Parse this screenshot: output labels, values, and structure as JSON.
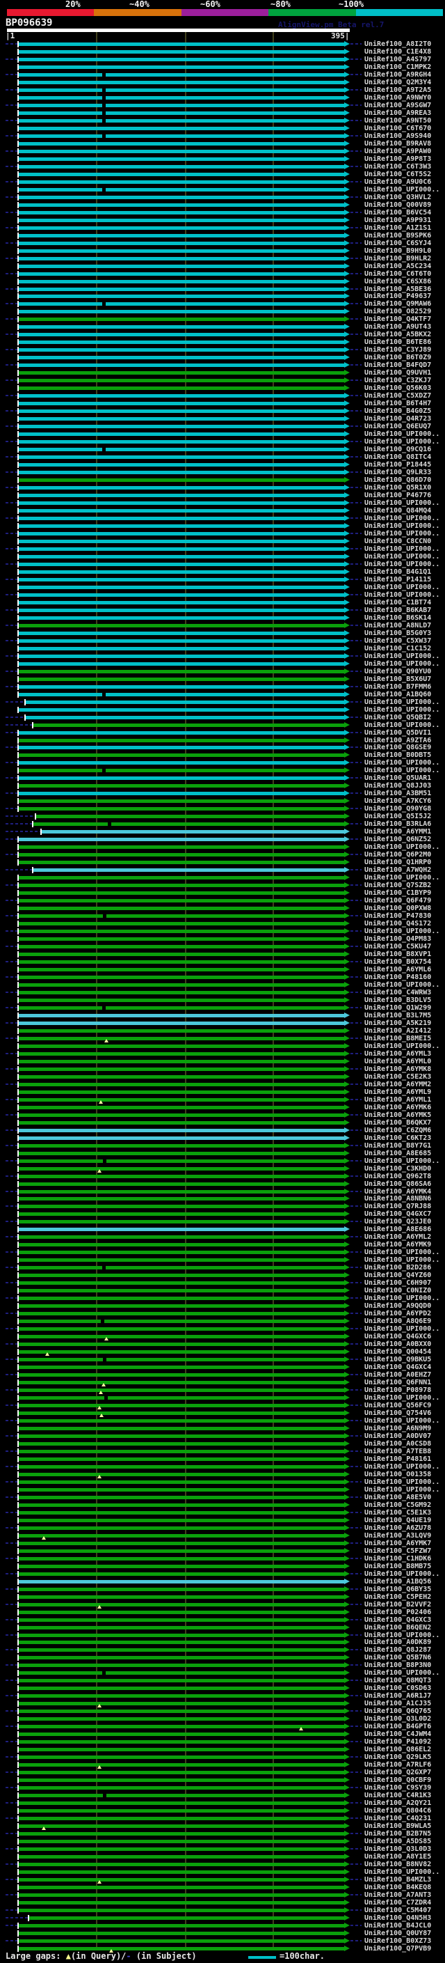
{
  "app": {
    "watermark": "AlignView.pm Beta rel.7"
  },
  "header": {
    "identity_scale": {
      "labels": [
        "20%",
        "~40%",
        "~60%",
        "~80%",
        "~100%"
      ],
      "colors": [
        "#e81930",
        "#d9730b",
        "#9c1f9c",
        "#00a33e",
        "#00bfc8"
      ]
    },
    "query_name": "BP096639",
    "ruler": {
      "start_label": "|1",
      "end_label": "395|",
      "start": 1,
      "end": 395
    }
  },
  "legend": {
    "large_gaps_prefix": "Large gaps: ",
    "query_gap_symbol": "▲",
    "large_gaps_mid": "(in Query)/",
    "subject_gap_symbol": "-",
    "large_gaps_suffix": " (in Subject)",
    "scale_key_label": "=100char."
  },
  "chart_data": {
    "type": "bar",
    "orientation": "horizontal",
    "title": "BP096639",
    "x_axis": {
      "min": 1,
      "max": 395,
      "gridlines": [
        100,
        200,
        300
      ]
    },
    "identity_legend": {
      "cyan": "~100%",
      "lcyan": "~100%",
      "green": "~80%"
    },
    "colors_hex": {
      "cyan": "#00c0c8",
      "lcyan": "#4cc8da",
      "green": "#0aa00b"
    },
    "rows": [
      {
        "l": "UniRef100_A8I2T0",
        "c": "cyan"
      },
      {
        "l": "UniRef100_C1E4X8",
        "c": "cyan"
      },
      {
        "l": "UniRef100_A4S797",
        "c": "cyan"
      },
      {
        "l": "UniRef100_C1MPK2",
        "c": "cyan"
      },
      {
        "l": "UniRef100_A9RGH4",
        "c": "cyan",
        "n": 147
      },
      {
        "l": "UniRef100_Q2M3Y4",
        "c": "cyan"
      },
      {
        "l": "UniRef100_A9T2A5",
        "c": "cyan",
        "n": 147
      },
      {
        "l": "UniRef100_A9NWY0",
        "c": "cyan",
        "n": 147
      },
      {
        "l": "UniRef100_A9SGW7",
        "c": "cyan",
        "n": 147
      },
      {
        "l": "UniRef100_A9REA3",
        "c": "cyan",
        "n": 147
      },
      {
        "l": "UniRef100_A9NT50",
        "c": "cyan",
        "n": 147
      },
      {
        "l": "UniRef100_C6T670",
        "c": "cyan"
      },
      {
        "l": "UniRef100_A9S940",
        "c": "cyan",
        "n": 147
      },
      {
        "l": "UniRef100_B9RAV8",
        "c": "cyan"
      },
      {
        "l": "UniRef100_A9PAW0",
        "c": "cyan"
      },
      {
        "l": "UniRef100_A9P8T3",
        "c": "cyan"
      },
      {
        "l": "UniRef100_C6T3W3",
        "c": "cyan"
      },
      {
        "l": "UniRef100_C6T5S2",
        "c": "cyan"
      },
      {
        "l": "UniRef100_A9U0C6",
        "c": "cyan"
      },
      {
        "l": "UniRef100_UPI000..",
        "c": "cyan",
        "n": 147
      },
      {
        "l": "UniRef100_Q3HVL2",
        "c": "cyan"
      },
      {
        "l": "UniRef100_Q00V89",
        "c": "cyan"
      },
      {
        "l": "UniRef100_B6VC54",
        "c": "cyan"
      },
      {
        "l": "UniRef100_A9P931",
        "c": "cyan"
      },
      {
        "l": "UniRef100_A1Z1S1",
        "c": "cyan"
      },
      {
        "l": "UniRef100_B9SPK6",
        "c": "cyan"
      },
      {
        "l": "UniRef100_C6SYJ4",
        "c": "cyan"
      },
      {
        "l": "UniRef100_B9H9L0",
        "c": "cyan"
      },
      {
        "l": "UniRef100_B9HLR2",
        "c": "cyan"
      },
      {
        "l": "UniRef100_A5C234",
        "c": "cyan"
      },
      {
        "l": "UniRef100_C6T6T0",
        "c": "cyan"
      },
      {
        "l": "UniRef100_C6SX86",
        "c": "cyan"
      },
      {
        "l": "UniRef100_A5BE36",
        "c": "cyan"
      },
      {
        "l": "UniRef100_P49637",
        "c": "cyan"
      },
      {
        "l": "UniRef100_Q9MAW6",
        "c": "cyan",
        "n": 147
      },
      {
        "l": "UniRef100_O82529",
        "c": "cyan"
      },
      {
        "l": "UniRef100_Q4KTF7",
        "c": "green"
      },
      {
        "l": "UniRef100_A9UT43",
        "c": "cyan"
      },
      {
        "l": "UniRef100_A5BKX2",
        "c": "cyan"
      },
      {
        "l": "UniRef100_B6TE86",
        "c": "cyan"
      },
      {
        "l": "UniRef100_C3YJ89",
        "c": "cyan"
      },
      {
        "l": "UniRef100_B6T0Z9",
        "c": "cyan"
      },
      {
        "l": "UniRef100_B4FQD7",
        "c": "cyan"
      },
      {
        "l": "UniRef100_Q9UVH1",
        "c": "green"
      },
      {
        "l": "UniRef100_C3ZKJ7",
        "c": "green"
      },
      {
        "l": "UniRef100_Q56K03",
        "c": "green"
      },
      {
        "l": "UniRef100_C5XDZ7",
        "c": "cyan"
      },
      {
        "l": "UniRef100_B6T4H7",
        "c": "cyan"
      },
      {
        "l": "UniRef100_B4G0Z5",
        "c": "cyan"
      },
      {
        "l": "UniRef100_Q4R723",
        "c": "cyan"
      },
      {
        "l": "UniRef100_Q6EUQ7",
        "c": "cyan"
      },
      {
        "l": "UniRef100_UPI000..",
        "c": "cyan"
      },
      {
        "l": "UniRef100_UPI000..",
        "c": "cyan"
      },
      {
        "l": "UniRef100_Q9CQ16",
        "c": "cyan",
        "n": 147
      },
      {
        "l": "UniRef100_Q8ITC4",
        "c": "cyan"
      },
      {
        "l": "UniRef100_P18445",
        "c": "cyan"
      },
      {
        "l": "UniRef100_Q9LR33",
        "c": "cyan"
      },
      {
        "l": "UniRef100_Q86D70",
        "c": "green"
      },
      {
        "l": "UniRef100_Q5R1X0",
        "c": "cyan"
      },
      {
        "l": "UniRef100_P46776",
        "c": "cyan"
      },
      {
        "l": "UniRef100_UPI000..",
        "c": "cyan"
      },
      {
        "l": "UniRef100_Q84MQ4",
        "c": "cyan"
      },
      {
        "l": "UniRef100_UPI000..",
        "c": "cyan"
      },
      {
        "l": "UniRef100_UPI000..",
        "c": "cyan"
      },
      {
        "l": "UniRef100_UPI000..",
        "c": "cyan"
      },
      {
        "l": "UniRef100_C8CCN0",
        "c": "cyan"
      },
      {
        "l": "UniRef100_UPI000..",
        "c": "cyan"
      },
      {
        "l": "UniRef100_UPI000..",
        "c": "cyan"
      },
      {
        "l": "UniRef100_UPI000..",
        "c": "cyan"
      },
      {
        "l": "UniRef100_B4G1Q1",
        "c": "cyan"
      },
      {
        "l": "UniRef100_P14115",
        "c": "cyan"
      },
      {
        "l": "UniRef100_UPI000..",
        "c": "cyan"
      },
      {
        "l": "UniRef100_UPI000..",
        "c": "cyan"
      },
      {
        "l": "UniRef100_C1BT74",
        "c": "cyan"
      },
      {
        "l": "UniRef100_B6KAB7",
        "c": "cyan"
      },
      {
        "l": "UniRef100_B6SK14",
        "c": "cyan"
      },
      {
        "l": "UniRef100_A8NLD7",
        "c": "green"
      },
      {
        "l": "UniRef100_B5G0Y3",
        "c": "cyan"
      },
      {
        "l": "UniRef100_C5XW37",
        "c": "cyan"
      },
      {
        "l": "UniRef100_C1C152",
        "c": "cyan"
      },
      {
        "l": "UniRef100_UPI000..",
        "c": "cyan"
      },
      {
        "l": "UniRef100_UPI000..",
        "c": "cyan"
      },
      {
        "l": "UniRef100_Q90YU0",
        "c": "green"
      },
      {
        "l": "UniRef100_B5X6U7",
        "c": "green"
      },
      {
        "l": "UniRef100_B7FMM6",
        "c": "cyan"
      },
      {
        "l": "UniRef100_A1BQ60",
        "c": "cyan",
        "n": 147
      },
      {
        "l": "UniRef100_UPI000..",
        "c": "cyan",
        "s": 35
      },
      {
        "l": "UniRef100_UPI000..",
        "c": "cyan"
      },
      {
        "l": "UniRef100_Q5QBI2",
        "c": "cyan",
        "s": 35
      },
      {
        "l": "UniRef100_UPI000..",
        "c": "green",
        "s": 46
      },
      {
        "l": "UniRef100_Q5DVI1",
        "c": "cyan"
      },
      {
        "l": "UniRef100_A9ZTA6",
        "c": "green"
      },
      {
        "l": "UniRef100_Q8GSE9",
        "c": "cyan"
      },
      {
        "l": "UniRef100_B0DBT5",
        "c": "green"
      },
      {
        "l": "UniRef100_UPI000..",
        "c": "cyan"
      },
      {
        "l": "UniRef100_UPI000..",
        "c": "green",
        "n": 147
      },
      {
        "l": "UniRef100_Q5UAR1",
        "c": "cyan"
      },
      {
        "l": "UniRef100_Q8JJ03",
        "c": "green"
      },
      {
        "l": "UniRef100_A3BM51",
        "c": "cyan"
      },
      {
        "l": "UniRef100_A7KCY6",
        "c": "green"
      },
      {
        "l": "UniRef100_Q90YG8",
        "c": "green"
      },
      {
        "l": "UniRef100_Q5I5J2",
        "c": "green",
        "s": 50
      },
      {
        "l": "UniRef100_B3RLA6",
        "c": "green",
        "s": 46,
        "n": 155
      },
      {
        "l": "UniRef100_A6YMM1",
        "c": "lcyan",
        "s": 58
      },
      {
        "l": "UniRef100_Q6NZ52",
        "c": "lcyan"
      },
      {
        "l": "UniRef100_UPI000..",
        "c": "green"
      },
      {
        "l": "UniRef100_Q6P2M0",
        "c": "green"
      },
      {
        "l": "UniRef100_Q1HRP0",
        "c": "green"
      },
      {
        "l": "UniRef100_A7WQH2",
        "c": "lcyan",
        "s": 46
      },
      {
        "l": "UniRef100_UPI000..",
        "c": "green"
      },
      {
        "l": "UniRef100_Q7SZB2",
        "c": "green"
      },
      {
        "l": "UniRef100_C1BYP9",
        "c": "green"
      },
      {
        "l": "UniRef100_Q6F479",
        "c": "green"
      },
      {
        "l": "UniRef100_Q0PXW8",
        "c": "green"
      },
      {
        "l": "UniRef100_P47830",
        "c": "green",
        "n": 148
      },
      {
        "l": "UniRef100_Q4S172",
        "c": "green"
      },
      {
        "l": "UniRef100_UPI000..",
        "c": "green"
      },
      {
        "l": "UniRef100_Q4PM83",
        "c": "green"
      },
      {
        "l": "UniRef100_C5KU47",
        "c": "green"
      },
      {
        "l": "UniRef100_B8XVP1",
        "c": "green"
      },
      {
        "l": "UniRef100_B0X754",
        "c": "green"
      },
      {
        "l": "UniRef100_A6YML6",
        "c": "green"
      },
      {
        "l": "UniRef100_P48160",
        "c": "green"
      },
      {
        "l": "UniRef100_UPI000..",
        "c": "green"
      },
      {
        "l": "UniRef100_C4WRW3",
        "c": "green"
      },
      {
        "l": "UniRef100_B3DLV5",
        "c": "green"
      },
      {
        "l": "UniRef100_Q1W299",
        "c": "green",
        "n": 147
      },
      {
        "l": "UniRef100_B3L7M5",
        "c": "lcyan"
      },
      {
        "l": "UniRef100_A5K219",
        "c": "lcyan"
      },
      {
        "l": "UniRef100_A2I412",
        "c": "green"
      },
      {
        "l": "UniRef100_B8MEI5",
        "c": "green",
        "t": 150
      },
      {
        "l": "UniRef100_UPI000..",
        "c": "green"
      },
      {
        "l": "UniRef100_A6YML3",
        "c": "green"
      },
      {
        "l": "UniRef100_A6YML0",
        "c": "green"
      },
      {
        "l": "UniRef100_A6YMK8",
        "c": "green"
      },
      {
        "l": "UniRef100_C5E2K3",
        "c": "green"
      },
      {
        "l": "UniRef100_A6YMM2",
        "c": "green"
      },
      {
        "l": "UniRef100_A6YML9",
        "c": "green"
      },
      {
        "l": "UniRef100_A6YML1",
        "c": "green",
        "t": 142
      },
      {
        "l": "UniRef100_A6YMK6",
        "c": "green"
      },
      {
        "l": "UniRef100_A6YMK5",
        "c": "green"
      },
      {
        "l": "UniRef100_B6QKX7",
        "c": "green"
      },
      {
        "l": "UniRef100_C6ZQM6",
        "c": "lcyan"
      },
      {
        "l": "UniRef100_C6KT23",
        "c": "lcyan"
      },
      {
        "l": "UniRef100_B8Y7G1",
        "c": "green"
      },
      {
        "l": "UniRef100_A8E685",
        "c": "green"
      },
      {
        "l": "UniRef100_UPI000..",
        "c": "green",
        "n": 148
      },
      {
        "l": "UniRef100_C3KHD0",
        "c": "green",
        "t": 140
      },
      {
        "l": "UniRef100_Q962T8",
        "c": "green"
      },
      {
        "l": "UniRef100_Q86SA6",
        "c": "green"
      },
      {
        "l": "UniRef100_A6YMK4",
        "c": "green"
      },
      {
        "l": "UniRef100_A8NBN6",
        "c": "green"
      },
      {
        "l": "UniRef100_Q7RJ88",
        "c": "green"
      },
      {
        "l": "UniRef100_Q4GXC7",
        "c": "green"
      },
      {
        "l": "UniRef100_Q23JE0",
        "c": "green"
      },
      {
        "l": "UniRef100_A8E686",
        "c": "lcyan"
      },
      {
        "l": "UniRef100_A6YML2",
        "c": "green"
      },
      {
        "l": "UniRef100_A6YMK9",
        "c": "green"
      },
      {
        "l": "UniRef100_UPI000..",
        "c": "green"
      },
      {
        "l": "UniRef100_UPI000..",
        "c": "green"
      },
      {
        "l": "UniRef100_B2D286",
        "c": "green",
        "n": 147
      },
      {
        "l": "UniRef100_Q4YZ60",
        "c": "green"
      },
      {
        "l": "UniRef100_C6H907",
        "c": "green"
      },
      {
        "l": "UniRef100_C0NIZ0",
        "c": "green"
      },
      {
        "l": "UniRef100_UPI000..",
        "c": "green"
      },
      {
        "l": "UniRef100_A9QQD0",
        "c": "green"
      },
      {
        "l": "UniRef100_A6YPD2",
        "c": "green"
      },
      {
        "l": "UniRef100_A8Q6E9",
        "c": "green",
        "n": 145
      },
      {
        "l": "UniRef100_UPI000..",
        "c": "green"
      },
      {
        "l": "UniRef100_Q4GXC6",
        "c": "green",
        "t": 150
      },
      {
        "l": "UniRef100_A0BXX0",
        "c": "green"
      },
      {
        "l": "UniRef100_Q00454",
        "c": "green",
        "t": 65
      },
      {
        "l": "UniRef100_Q9BKU5",
        "c": "green",
        "n": 148
      },
      {
        "l": "UniRef100_Q4GXC4",
        "c": "green"
      },
      {
        "l": "UniRef100_A0EHZ7",
        "c": "green"
      },
      {
        "l": "UniRef100_Q6FNN1",
        "c": "green",
        "t": 146
      },
      {
        "l": "UniRef100_P08978",
        "c": "green",
        "t": 142
      },
      {
        "l": "UniRef100_UPI000..",
        "c": "green",
        "n": 150
      },
      {
        "l": "UniRef100_Q56FC9",
        "c": "green",
        "t": 140
      },
      {
        "l": "UniRef100_Q754V6",
        "c": "green",
        "t": 143
      },
      {
        "l": "UniRef100_UPI000..",
        "c": "green"
      },
      {
        "l": "UniRef100_A6N9M9",
        "c": "green"
      },
      {
        "l": "UniRef100_A0DV07",
        "c": "green"
      },
      {
        "l": "UniRef100_A0CSD8",
        "c": "green"
      },
      {
        "l": "UniRef100_A7TEB8",
        "c": "green"
      },
      {
        "l": "UniRef100_P48161",
        "c": "green"
      },
      {
        "l": "UniRef100_UPI000..",
        "c": "green"
      },
      {
        "l": "UniRef100_O01358",
        "c": "green",
        "t": 140
      },
      {
        "l": "UniRef100_UPI000..",
        "c": "green"
      },
      {
        "l": "UniRef100_UPI000..",
        "c": "green"
      },
      {
        "l": "UniRef100_A8E5V0",
        "c": "green"
      },
      {
        "l": "UniRef100_C5GM92",
        "c": "green"
      },
      {
        "l": "UniRef100_C5E1K3",
        "c": "green"
      },
      {
        "l": "UniRef100_Q4UE19",
        "c": "green"
      },
      {
        "l": "UniRef100_A6ZU78",
        "c": "green"
      },
      {
        "l": "UniRef100_A3LQV9",
        "c": "green",
        "t": 60
      },
      {
        "l": "UniRef100_A6YMK7",
        "c": "green"
      },
      {
        "l": "UniRef100_C5FZW7",
        "c": "green"
      },
      {
        "l": "UniRef100_C1HDK6",
        "c": "green"
      },
      {
        "l": "UniRef100_B8MB75",
        "c": "green"
      },
      {
        "l": "UniRef100_UPI000..",
        "c": "green"
      },
      {
        "l": "UniRef100_A1BQ56",
        "c": "lcyan"
      },
      {
        "l": "UniRef100_Q6BY35",
        "c": "green"
      },
      {
        "l": "UniRef100_C5PEH2",
        "c": "green"
      },
      {
        "l": "UniRef100_B2VVF2",
        "c": "green",
        "t": 140
      },
      {
        "l": "UniRef100_P02406",
        "c": "green"
      },
      {
        "l": "UniRef100_Q4GXC3",
        "c": "green"
      },
      {
        "l": "UniRef100_B6QEN2",
        "c": "green"
      },
      {
        "l": "UniRef100_UPI000..",
        "c": "green"
      },
      {
        "l": "UniRef100_A0DK89",
        "c": "green"
      },
      {
        "l": "UniRef100_Q8J287",
        "c": "green"
      },
      {
        "l": "UniRef100_Q5B7N6",
        "c": "green"
      },
      {
        "l": "UniRef100_B8P3N0",
        "c": "green"
      },
      {
        "l": "UniRef100_UPI000..",
        "c": "green",
        "n": 147
      },
      {
        "l": "UniRef100_Q8MQT3",
        "c": "green"
      },
      {
        "l": "UniRef100_C0SD63",
        "c": "green"
      },
      {
        "l": "UniRef100_A6R1J7",
        "c": "green"
      },
      {
        "l": "UniRef100_A1CJ35",
        "c": "green",
        "t": 140
      },
      {
        "l": "UniRef100_Q6Q765",
        "c": "green"
      },
      {
        "l": "UniRef100_Q3L0D2",
        "c": "green"
      },
      {
        "l": "UniRef100_B4GPT6",
        "c": "green",
        "t": 430
      },
      {
        "l": "UniRef100_C4JWM4",
        "c": "green"
      },
      {
        "l": "UniRef100_P41092",
        "c": "green"
      },
      {
        "l": "UniRef100_Q86EL2",
        "c": "green"
      },
      {
        "l": "UniRef100_Q29LK5",
        "c": "green"
      },
      {
        "l": "UniRef100_A7RLF6",
        "c": "green",
        "t": 140
      },
      {
        "l": "UniRef100_Q2GXP7",
        "c": "green"
      },
      {
        "l": "UniRef100_Q0CBF9",
        "c": "green"
      },
      {
        "l": "UniRef100_C9SY39",
        "c": "green"
      },
      {
        "l": "UniRef100_C4R1K3",
        "c": "green",
        "n": 148
      },
      {
        "l": "UniRef100_A2QY21",
        "c": "green"
      },
      {
        "l": "UniRef100_Q804C6",
        "c": "green"
      },
      {
        "l": "UniRef100_C4Q231",
        "c": "green"
      },
      {
        "l": "UniRef100_B9WLA5",
        "c": "green",
        "t": 60
      },
      {
        "l": "UniRef100_B2B7N5",
        "c": "green"
      },
      {
        "l": "UniRef100_A5DS85",
        "c": "green"
      },
      {
        "l": "UniRef100_Q3L0D3",
        "c": "green"
      },
      {
        "l": "UniRef100_A8Y1E5",
        "c": "green"
      },
      {
        "l": "UniRef100_B8NV82",
        "c": "green"
      },
      {
        "l": "UniRef100_UPI000..",
        "c": "green"
      },
      {
        "l": "UniRef100_B4MZL3",
        "c": "green",
        "t": 140
      },
      {
        "l": "UniRef100_B4KEQ8",
        "c": "green"
      },
      {
        "l": "UniRef100_A7ANT3",
        "c": "green"
      },
      {
        "l": "UniRef100_C7ZDR4",
        "c": "green"
      },
      {
        "l": "UniRef100_C5M407",
        "c": "green"
      },
      {
        "l": "UniRef100_Q4N5H3",
        "c": "green",
        "s": 40
      },
      {
        "l": "UniRef100_B4JCL0",
        "c": "green"
      },
      {
        "l": "UniRef100_Q0UY87",
        "c": "green"
      },
      {
        "l": "UniRef100_B0XZ73",
        "c": "green"
      },
      {
        "l": "UniRef100_Q7PVB9",
        "c": "green",
        "t": 157
      }
    ]
  }
}
